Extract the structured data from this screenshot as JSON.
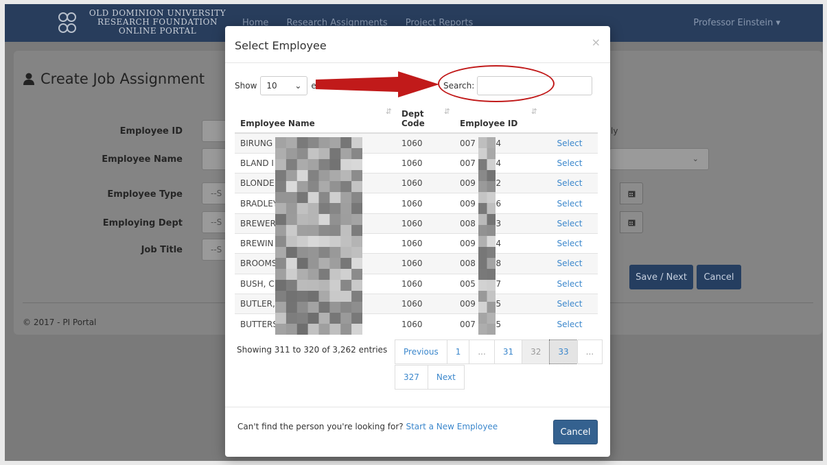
{
  "app": {
    "logo_lines": [
      "OLD DOMINION UNIVERSITY",
      "RESEARCH FOUNDATION",
      "ONLINE PORTAL"
    ],
    "nav": [
      "Home",
      "Research Assignments",
      "Project Reports"
    ],
    "user": "Professor Einstein ▾"
  },
  "background_form": {
    "title": "Create Job Assignment",
    "labels": [
      "Employee ID",
      "Employee Name",
      "Employee Type",
      "Employing Dept",
      "Job Title"
    ],
    "select_placeholder": "--S",
    "right_field_text": "ly",
    "save_label": "Save / Next",
    "cancel_label": "Cancel",
    "footer": "© 2017 - PI Portal"
  },
  "modal": {
    "title": "Select Employee",
    "close": "×",
    "show_label": "Show",
    "page_length": "10",
    "entries_label": "ent",
    "search_label": "Search:",
    "search_value": "",
    "columns": [
      "Employee Name",
      "Dept Code",
      "Employee ID",
      ""
    ],
    "rows": [
      {
        "name": "BIRUNG",
        "dept": "1060",
        "id_start": "007",
        "id_end": "84",
        "action": "Select"
      },
      {
        "name": "BLAND I",
        "dept": "1060",
        "id_start": "007",
        "id_end": "54",
        "action": "Select"
      },
      {
        "name": "BLONDE",
        "dept": "1060",
        "id_start": "009",
        "id_end": "52",
        "action": "Select"
      },
      {
        "name": "BRADLEY",
        "dept": "1060",
        "id_start": "009",
        "id_end": "36",
        "action": "Select"
      },
      {
        "name": "BREWER",
        "dept": "1060",
        "id_start": "008",
        "id_end": "83",
        "action": "Select"
      },
      {
        "name": "BREWIN",
        "dept": "1060",
        "id_start": "009",
        "id_end": "64",
        "action": "Select"
      },
      {
        "name": "BROOMS",
        "dept": "1060",
        "id_start": "008",
        "id_end": "68",
        "action": "Select"
      },
      {
        "name": "BUSH, C",
        "dept": "1060",
        "id_start": "005",
        "id_end": "07",
        "action": "Select"
      },
      {
        "name": "BUTLER,",
        "dept": "1060",
        "id_start": "009",
        "id_end": "25",
        "action": "Select"
      },
      {
        "name": "BUTTERS",
        "dept": "1060",
        "id_start": "007",
        "id_end": "55",
        "action": "Select"
      }
    ],
    "info": "Showing 311 to 320 of 3,262 entries",
    "pagination": {
      "previous": "Previous",
      "pages_row1": [
        "1",
        "...",
        "31",
        "32",
        "33",
        "..."
      ],
      "pages_row2": [
        "327"
      ],
      "next": "Next",
      "current": "33"
    },
    "footer_text": "Can't find the person you're looking for?",
    "footer_link": "Start a New Employee",
    "cancel_label": "Cancel"
  },
  "colors": {
    "navbar": "#283d5c",
    "link": "#3b87cc",
    "primary_button": "#34618f",
    "annotation_red": "#c11a1a"
  }
}
